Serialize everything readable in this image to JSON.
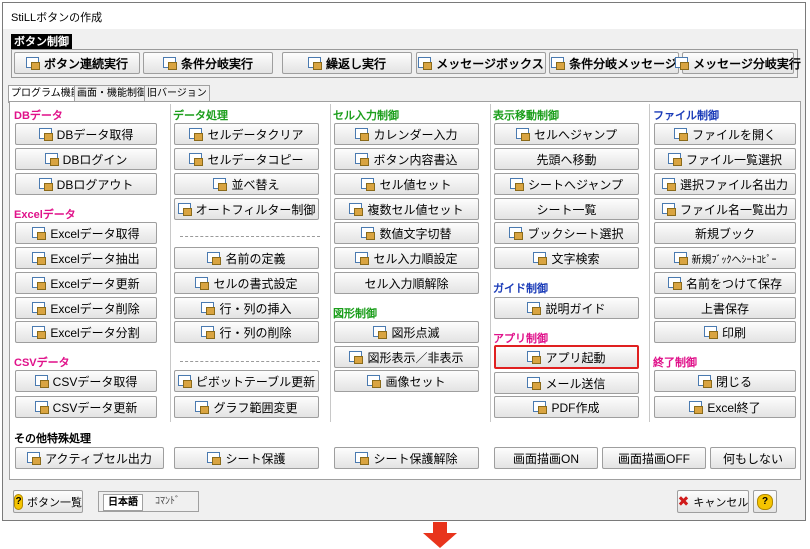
{
  "window_title": "StiLLボタンの作成",
  "panel": {
    "header": "ボタン制御",
    "buttons": [
      "ボタン連続実行",
      "条件分岐実行",
      "繰返し実行",
      "メッセージボックス",
      "条件分岐メッセージ",
      "メッセージ分岐実行"
    ]
  },
  "tabs": [
    "プログラム機能",
    "画面・機能制御",
    "旧バージョン"
  ],
  "col1": {
    "db": {
      "title": "DBデータ",
      "buttons": [
        "DBデータ取得",
        "DBログイン",
        "DBログアウト"
      ]
    },
    "excel": {
      "title": "Excelデータ",
      "buttons": [
        "Excelデータ取得",
        "Excelデータ抽出",
        "Excelデータ更新",
        "Excelデータ削除",
        "Excelデータ分割"
      ]
    },
    "csv": {
      "title": "CSVデータ",
      "buttons": [
        "CSVデータ取得",
        "CSVデータ更新"
      ]
    }
  },
  "col2": {
    "title": "データ処理",
    "buttons": [
      "セルデータクリア",
      "セルデータコピー",
      "並べ替え",
      "オートフィルター制御",
      "名前の定義",
      "セルの書式設定",
      "行・列の挿入",
      "行・列の削除",
      "ピボットテーブル更新",
      "グラフ範囲変更"
    ]
  },
  "col3": {
    "cell": {
      "title": "セル入力制御",
      "buttons": [
        "カレンダー入力",
        "ボタン内容書込",
        "セル値セット",
        "複数セル値セット",
        "数値文字切替",
        "セル入力順設定",
        "セル入力順解除"
      ]
    },
    "shape": {
      "title": "図形制御",
      "buttons": [
        "図形点滅",
        "図形表示／非表示",
        "画像セット"
      ]
    }
  },
  "col4": {
    "move": {
      "title": "表示移動制御",
      "buttons": [
        "セルへジャンプ",
        "先頭へ移動",
        "シートへジャンプ",
        "シート一覧",
        "ブックシート選択",
        "文字検索"
      ]
    },
    "guide": {
      "title": "ガイド制御",
      "buttons": [
        "説明ガイド"
      ]
    },
    "app": {
      "title": "アプリ制御",
      "buttons": [
        "アプリ起動",
        "メール送信",
        "PDF作成"
      ]
    }
  },
  "col5": {
    "file": {
      "title": "ファイル制御",
      "buttons": [
        "ファイルを開く",
        "ファイル一覧選択",
        "選択ファイル名出力",
        "ファイル名一覧出力",
        "新規ブック",
        "新規ﾌﾞｯｸへｼｰﾄｺﾋﾟｰ",
        "名前をつけて保存",
        "上書保存",
        "印刷"
      ]
    },
    "end": {
      "title": "終了制御",
      "buttons": [
        "閉じる",
        "Excel終了"
      ]
    }
  },
  "other": {
    "title": "その他特殊処理",
    "buttons": [
      "アクティブセル出力",
      "シート保護",
      "シート保護解除",
      "画面描画ON",
      "画面描画OFF",
      "何もしない"
    ]
  },
  "footer": {
    "help_list": "ボタン一覧",
    "lang_jp": "日本語",
    "lang_cmd": "ｺﾏﾝﾄﾞ",
    "cancel": "キャンセル",
    "help_q": "?"
  },
  "colors": {
    "accent_red": "#e02020",
    "arrow_red": "#e8341c"
  }
}
